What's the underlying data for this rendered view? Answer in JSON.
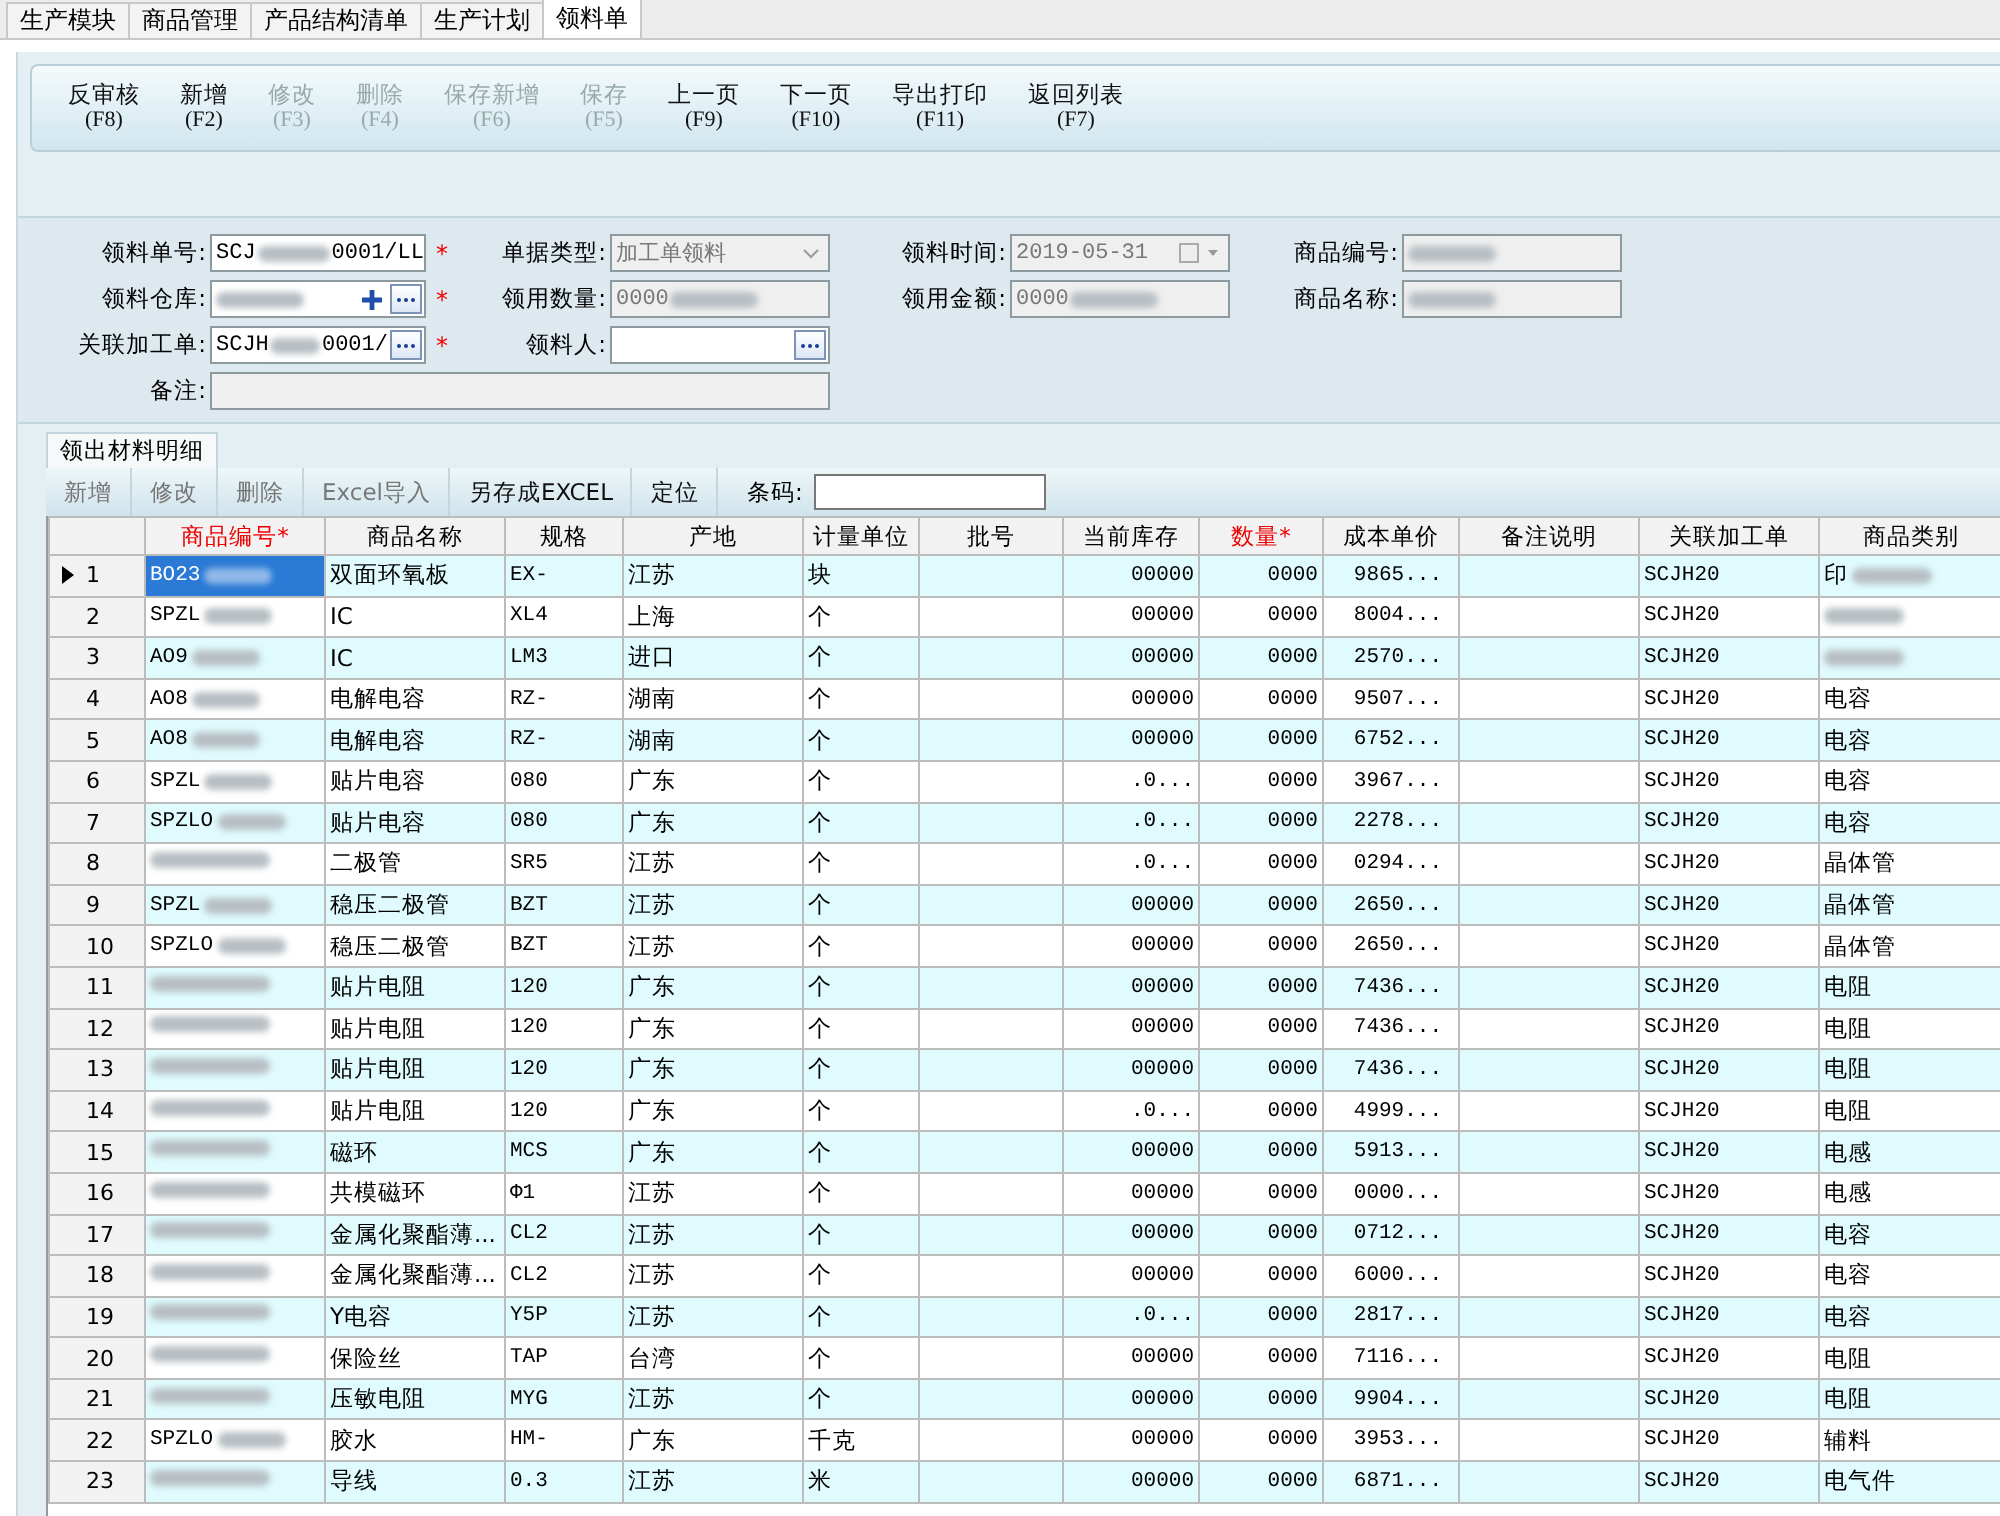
{
  "tabs": [
    {
      "label": "生产模块",
      "selected": false
    },
    {
      "label": "商品管理",
      "selected": false
    },
    {
      "label": "产品结构清单",
      "selected": false
    },
    {
      "label": "生产计划",
      "selected": false
    },
    {
      "label": "领料单",
      "selected": true
    }
  ],
  "toolbar": [
    {
      "label": "反审核",
      "key": "(F8)",
      "disabled": false
    },
    {
      "label": "新增",
      "key": "(F2)",
      "disabled": false
    },
    {
      "label": "修改",
      "key": "(F3)",
      "disabled": true
    },
    {
      "label": "删除",
      "key": "(F4)",
      "disabled": true
    },
    {
      "label": "保存新增",
      "key": "(F6)",
      "disabled": true
    },
    {
      "label": "保存",
      "key": "(F5)",
      "disabled": true
    },
    {
      "label": "上一页",
      "key": "(F9)",
      "disabled": false
    },
    {
      "label": "下一页",
      "key": "(F10)",
      "disabled": false
    },
    {
      "label": "导出打印",
      "key": "(F11)",
      "disabled": false
    },
    {
      "label": "返回列表",
      "key": "(F7)",
      "disabled": false
    }
  ],
  "form": {
    "rows": [
      [
        {
          "label": "领料单号:",
          "kind": "text",
          "parts": [
            "SCJ",
            "0001/LL"
          ],
          "redacted": true,
          "required_mark": "*",
          "disabled": false
        },
        {
          "label": "单据类型:",
          "kind": "select",
          "parts": [
            "加工单领料"
          ],
          "redacted": false,
          "disabled": true
        },
        {
          "label": "领料时间:",
          "kind": "date",
          "parts": [
            "2019-05-31"
          ],
          "redacted": false,
          "disabled": true
        },
        {
          "label": "商品编号:",
          "kind": "text",
          "redacted": true,
          "disabled": true
        }
      ],
      [
        {
          "label": "领料仓库:",
          "kind": "lookup_add",
          "redacted": true,
          "required_mark": "*",
          "disabled": false
        },
        {
          "label": "领用数量:",
          "kind": "text",
          "parts": [
            "0000"
          ],
          "redacted": true,
          "disabled": true
        },
        {
          "label": "领用金额:",
          "kind": "text",
          "parts": [
            "0000"
          ],
          "redacted": true,
          "disabled": true
        },
        {
          "label": "商品名称:",
          "kind": "text",
          "redacted": true,
          "disabled": true
        }
      ],
      [
        {
          "label": "关联加工单:",
          "kind": "lookup",
          "parts": [
            "SCJH",
            "0001/"
          ],
          "redacted": true,
          "required_mark": "*",
          "disabled": false
        },
        {
          "label": "领料人:",
          "kind": "lookup",
          "redacted": false,
          "disabled": false
        }
      ],
      [
        {
          "label": "备注:",
          "kind": "wide",
          "redacted": false,
          "disabled": true
        }
      ]
    ]
  },
  "detail_tab": {
    "label": "领出材料明细",
    "selected": true
  },
  "grid_toolbar": {
    "buttons": [
      {
        "label": "新增",
        "disabled": true
      },
      {
        "label": "修改",
        "disabled": true
      },
      {
        "label": "删除",
        "disabled": true
      },
      {
        "label": "Excel导入",
        "disabled": true
      },
      {
        "label": "另存成EXCEL",
        "disabled": false
      },
      {
        "label": "定位",
        "disabled": false
      }
    ],
    "barcode_label": "条码:"
  },
  "columns": [
    {
      "label": "商品编号*",
      "required": true
    },
    {
      "label": "商品名称",
      "required": false
    },
    {
      "label": "规格",
      "required": false
    },
    {
      "label": "产地",
      "required": false
    },
    {
      "label": "计量单位",
      "required": false
    },
    {
      "label": "批号",
      "required": false
    },
    {
      "label": "当前库存",
      "required": false
    },
    {
      "label": "数量*",
      "required": true
    },
    {
      "label": "成本单价",
      "required": false
    },
    {
      "label": "备注说明",
      "required": false
    },
    {
      "label": "关联加工单",
      "required": false
    },
    {
      "label": "商品类别",
      "required": false
    }
  ],
  "rows": [
    {
      "no": "1",
      "selected": true,
      "code": "BO23",
      "name": "双面环氧板",
      "spec": "EX-",
      "origin": "江苏",
      "unit": "块",
      "stock": "00000",
      "qty": "0000",
      "price": "9865...",
      "order": "SCJH20",
      "category": "印",
      "category_redacted": true
    },
    {
      "no": "2",
      "selected": false,
      "code": "SPZL",
      "name": "IC",
      "spec": "XL4",
      "origin": "上海",
      "unit": "个",
      "stock": "00000",
      "qty": "0000",
      "price": "8004...",
      "order": "SCJH20",
      "category_redacted": true
    },
    {
      "no": "3",
      "selected": false,
      "code": "AO9",
      "name": "IC",
      "spec": "LM3",
      "origin": "进口",
      "unit": "个",
      "stock": "00000",
      "qty": "0000",
      "price": "2570...",
      "order": "SCJH20",
      "category_redacted": true
    },
    {
      "no": "4",
      "selected": false,
      "code": "AO8",
      "name": "电解电容",
      "spec": "RZ-",
      "origin": "湖南",
      "unit": "个",
      "stock": "00000",
      "qty": "0000",
      "price": "9507...",
      "order": "SCJH20",
      "category": "电容",
      "category_redacted": false
    },
    {
      "no": "5",
      "selected": false,
      "code": "AO8",
      "name": "电解电容",
      "spec": "RZ-",
      "origin": "湖南",
      "unit": "个",
      "stock": "00000",
      "qty": "0000",
      "price": "6752...",
      "order": "SCJH20",
      "category": "电容",
      "category_redacted": false
    },
    {
      "no": "6",
      "selected": false,
      "code": "SPZL",
      "name": "贴片电容",
      "spec": "080",
      "origin": "广东",
      "unit": "个",
      "stock": ".0...",
      "qty": "0000",
      "price": "3967...",
      "order": "SCJH20",
      "category": "电容",
      "category_redacted": false
    },
    {
      "no": "7",
      "selected": false,
      "code": "SPZLO",
      "name": "贴片电容",
      "spec": "080",
      "origin": "广东",
      "unit": "个",
      "stock": ".0...",
      "qty": "0000",
      "price": "2278...",
      "order": "SCJH20",
      "category": "电容",
      "category_redacted": false
    },
    {
      "no": "8",
      "selected": false,
      "name": "二极管",
      "spec": "SR5",
      "origin": "江苏",
      "unit": "个",
      "stock": ".0...",
      "qty": "0000",
      "price": "0294...",
      "order": "SCJH20",
      "category": "晶体管",
      "category_redacted": false
    },
    {
      "no": "9",
      "selected": false,
      "code": "SPZL",
      "name": "稳压二极管",
      "spec": "BZT",
      "origin": "江苏",
      "unit": "个",
      "stock": "00000",
      "qty": "0000",
      "price": "2650...",
      "order": "SCJH20",
      "category": "晶体管",
      "category_redacted": false
    },
    {
      "no": "10",
      "selected": false,
      "code": "SPZLO",
      "name": "稳压二极管",
      "spec": "BZT",
      "origin": "江苏",
      "unit": "个",
      "stock": "00000",
      "qty": "0000",
      "price": "2650...",
      "order": "SCJH20",
      "category": "晶体管",
      "category_redacted": false
    },
    {
      "no": "11",
      "selected": false,
      "name": "贴片电阻",
      "spec": "120",
      "origin": "广东",
      "unit": "个",
      "stock": "00000",
      "qty": "0000",
      "price": "7436...",
      "order": "SCJH20",
      "category": "电阻",
      "category_redacted": false
    },
    {
      "no": "12",
      "selected": false,
      "name": "贴片电阻",
      "spec": "120",
      "origin": "广东",
      "unit": "个",
      "stock": "00000",
      "qty": "0000",
      "price": "7436...",
      "order": "SCJH20",
      "category": "电阻",
      "category_redacted": false
    },
    {
      "no": "13",
      "selected": false,
      "name": "贴片电阻",
      "spec": "120",
      "origin": "广东",
      "unit": "个",
      "stock": "00000",
      "qty": "0000",
      "price": "7436...",
      "order": "SCJH20",
      "category": "电阻",
      "category_redacted": false
    },
    {
      "no": "14",
      "selected": false,
      "name": "贴片电阻",
      "spec": "120",
      "origin": "广东",
      "unit": "个",
      "stock": ".0...",
      "qty": "0000",
      "price": "4999...",
      "order": "SCJH20",
      "category": "电阻",
      "category_redacted": false
    },
    {
      "no": "15",
      "selected": false,
      "name": "磁环",
      "spec": "MCS",
      "origin": "广东",
      "unit": "个",
      "stock": "00000",
      "qty": "0000",
      "price": "5913...",
      "order": "SCJH20",
      "category": "电感",
      "category_redacted": false
    },
    {
      "no": "16",
      "selected": false,
      "name": "共模磁环",
      "spec": "Φ1",
      "origin": "江苏",
      "unit": "个",
      "stock": "00000",
      "qty": "0000",
      "price": "0000...",
      "order": "SCJH20",
      "category": "电感",
      "category_redacted": false
    },
    {
      "no": "17",
      "selected": false,
      "name": "金属化聚酯薄...",
      "spec": "CL2",
      "origin": "江苏",
      "unit": "个",
      "stock": "00000",
      "qty": "0000",
      "price": "0712...",
      "order": "SCJH20",
      "category": "电容",
      "category_redacted": false
    },
    {
      "no": "18",
      "selected": false,
      "name": "金属化聚酯薄...",
      "spec": "CL2",
      "origin": "江苏",
      "unit": "个",
      "stock": "00000",
      "qty": "0000",
      "price": "6000...",
      "order": "SCJH20",
      "category": "电容",
      "category_redacted": false
    },
    {
      "no": "19",
      "selected": false,
      "name": "Y电容",
      "spec": "Y5P",
      "origin": "江苏",
      "unit": "个",
      "stock": ".0...",
      "qty": "0000",
      "price": "2817...",
      "order": "SCJH20",
      "category": "电容",
      "category_redacted": false
    },
    {
      "no": "20",
      "selected": false,
      "name": "保险丝",
      "spec": "TAP",
      "origin": "台湾",
      "unit": "个",
      "stock": "00000",
      "qty": "0000",
      "price": "7116...",
      "order": "SCJH20",
      "category": "电阻",
      "category_redacted": false
    },
    {
      "no": "21",
      "selected": false,
      "name": "压敏电阻",
      "spec": "MYG",
      "origin": "江苏",
      "unit": "个",
      "stock": "00000",
      "qty": "0000",
      "price": "9904...",
      "order": "SCJH20",
      "category": "电阻",
      "category_redacted": false
    },
    {
      "no": "22",
      "selected": false,
      "code": "SPZLO",
      "name": "胶水",
      "spec": "HM-",
      "origin": "广东",
      "unit": "千克",
      "stock": "00000",
      "qty": "0000",
      "price": "3953...",
      "order": "SCJH20",
      "category": "辅料",
      "category_redacted": false
    },
    {
      "no": "23",
      "selected": false,
      "name": "导线",
      "spec": "0.3",
      "origin": "江苏",
      "unit": "米",
      "stock": "00000",
      "qty": "0000",
      "price": "6871...",
      "order": "SCJH20",
      "category": "电气件",
      "category_redacted": false
    }
  ]
}
